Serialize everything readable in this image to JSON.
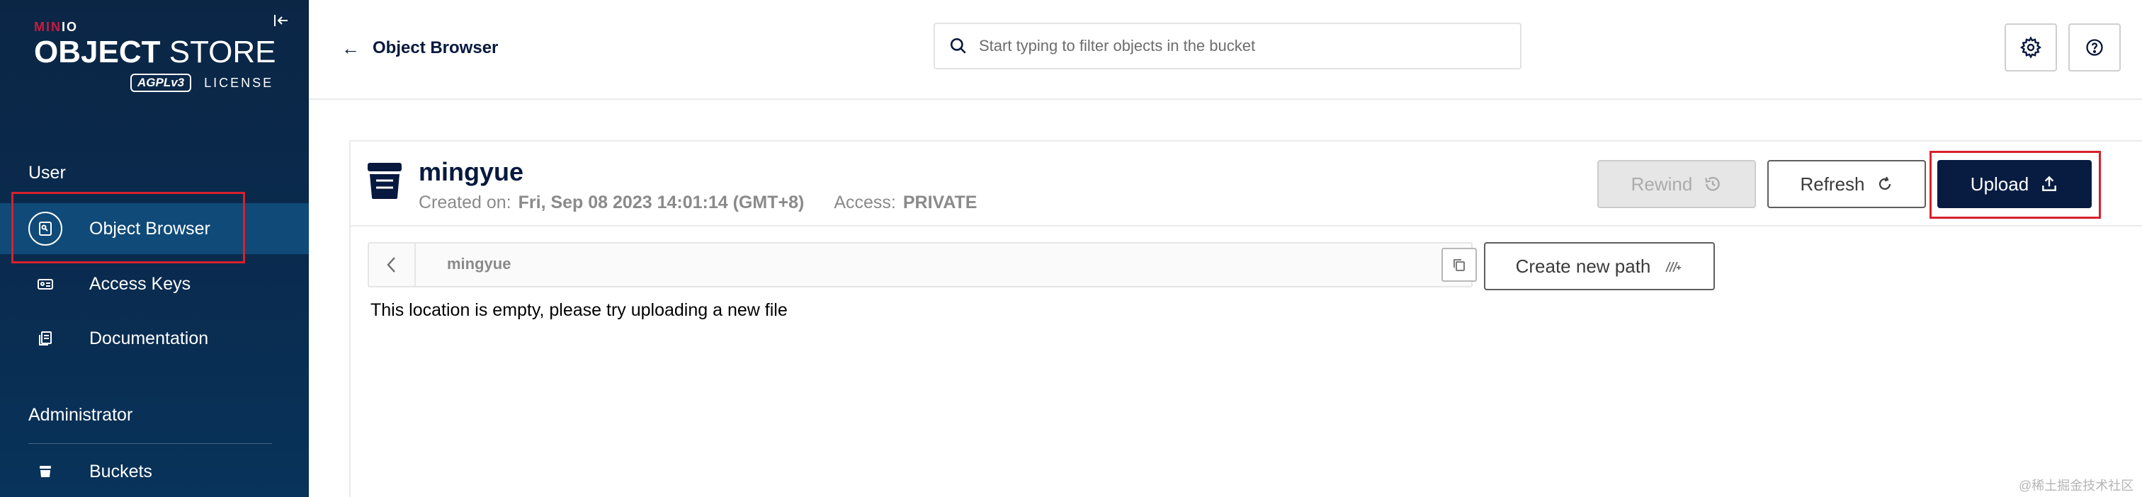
{
  "sidebar": {
    "logo": {
      "brand_prefix": "MIN",
      "brand_suffix": "IO",
      "title_bold": "OBJECT",
      "title_thin": "STORE",
      "badge": "AGPLv3",
      "license": "LICENSE"
    },
    "sections": {
      "user": "User",
      "admin": "Administrator"
    },
    "items": {
      "object_browser": "Object Browser",
      "access_keys": "Access Keys",
      "documentation": "Documentation",
      "buckets": "Buckets"
    },
    "active_item": "Object Browser",
    "colors": {
      "background": "#0b2645",
      "active": "#0f4a78"
    }
  },
  "header": {
    "back_label": "Object Browser",
    "search_placeholder": "Start typing to filter objects in the bucket",
    "icons": [
      "arrow-left-icon",
      "search-icon",
      "gear-icon",
      "help-icon"
    ]
  },
  "bucket": {
    "name": "mingyue",
    "created_label": "Created on:",
    "created_value": "Fri, Sep 08 2023 14:01:14 (GMT+8)",
    "access_label": "Access:",
    "access_value": "PRIVATE"
  },
  "actions": {
    "rewind": "Rewind",
    "refresh": "Refresh",
    "upload": "Upload",
    "create_path": "Create new path"
  },
  "path": {
    "current": "mingyue"
  },
  "content": {
    "empty_message": "This location is empty, please try uploading a new file"
  },
  "watermark": "@稀土掘金技术社区",
  "colors": {
    "primary": "#081c42",
    "highlight": "#d8202c",
    "disabled": "#e6e6e6"
  }
}
